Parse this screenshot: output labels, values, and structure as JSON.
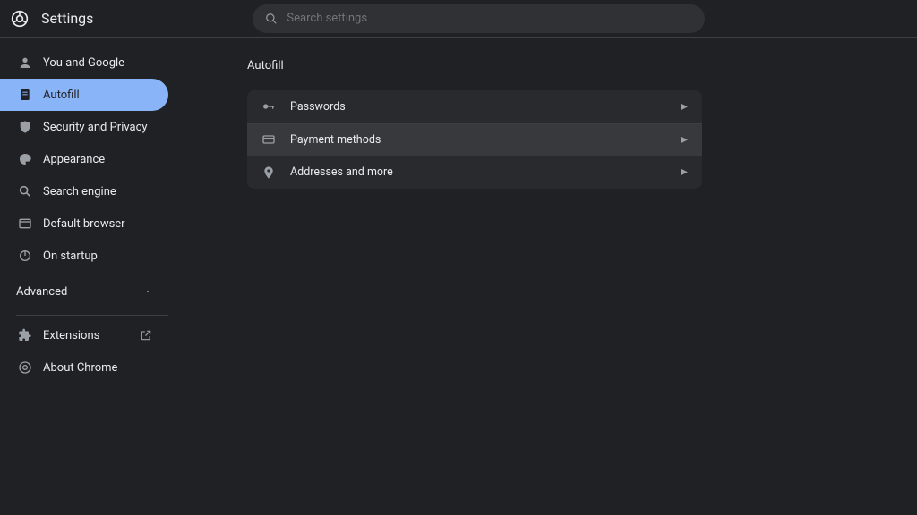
{
  "header": {
    "title": "Settings",
    "search_placeholder": "Search settings"
  },
  "sidebar": {
    "items": [
      {
        "label": "You and Google"
      },
      {
        "label": "Autofill"
      },
      {
        "label": "Security and Privacy"
      },
      {
        "label": "Appearance"
      },
      {
        "label": "Search engine"
      },
      {
        "label": "Default browser"
      },
      {
        "label": "On startup"
      }
    ],
    "advanced_label": "Advanced",
    "extensions_label": "Extensions",
    "about_label": "About Chrome"
  },
  "page": {
    "title": "Autofill",
    "rows": [
      {
        "label": "Passwords"
      },
      {
        "label": "Payment methods"
      },
      {
        "label": "Addresses and more"
      }
    ]
  }
}
